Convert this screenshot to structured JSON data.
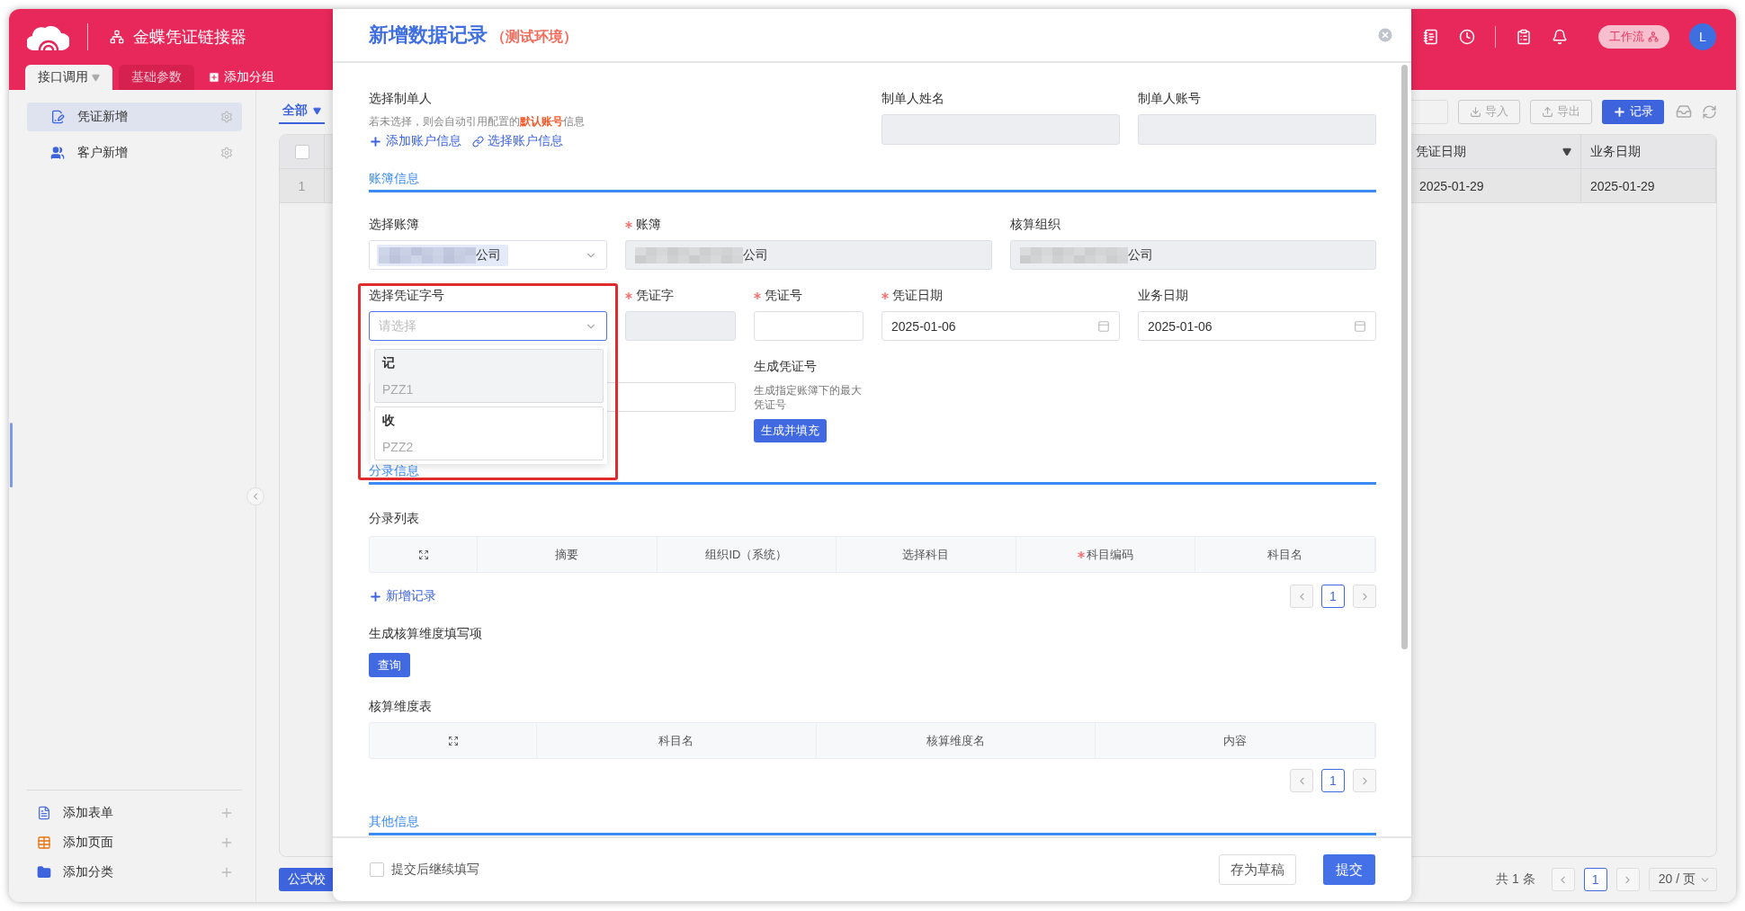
{
  "app": {
    "title": "金蝶凭证链接器",
    "workflow": "工作流",
    "avatar": "L"
  },
  "nav_tabs": [
    {
      "label": "接口调用",
      "selected": true
    },
    {
      "label": "基础参数",
      "selected": false
    }
  ],
  "add_group": "添加分组",
  "sidebar": {
    "items": [
      {
        "label": "凭证新增",
        "selected": true,
        "kind": "voucher"
      },
      {
        "label": "客户新增",
        "selected": false,
        "kind": "users"
      }
    ],
    "footer_items": [
      {
        "label": "添加表单",
        "kind": "form"
      },
      {
        "label": "添加页面",
        "kind": "page"
      },
      {
        "label": "添加分类",
        "kind": "folder"
      }
    ]
  },
  "filter_tab": {
    "label": "全部",
    "selected": true
  },
  "toolbar": [
    {
      "label": "导入",
      "kind": "import"
    },
    {
      "label": "导出",
      "kind": "export"
    },
    {
      "label": "记录",
      "kind": "add"
    }
  ],
  "table": {
    "select_all": {
      "checked": false
    },
    "columns": [
      {
        "label": "凭证日期",
        "filter": true
      },
      {
        "label": "业务日期",
        "filter": false
      }
    ],
    "rows": [
      {
        "index": "1",
        "cells": [
          "2025-01-29",
          "2025-01-29"
        ]
      }
    ]
  },
  "bottom": {
    "formula_button": "公式校",
    "total": "共 1 条",
    "page": "1",
    "page_size": "20 / 页"
  },
  "modal": {
    "title": "新增数据记录",
    "env": "（测试环境）",
    "creator": {
      "label": "选择制单人",
      "hint": "若未选择，则会自动引用配置的**默认账号**信息",
      "links": [
        {
          "label": "添加账户信息",
          "kind": "add"
        },
        {
          "label": "选择账户信息",
          "kind": "link"
        }
      ]
    },
    "creator_fields": [
      {
        "label": "制单人姓名",
        "disabled": true
      },
      {
        "label": "制单人账号",
        "disabled": true
      }
    ],
    "section_ledger": "账簿信息",
    "ledger_fields": [
      {
        "label": "选择账簿",
        "required": false,
        "kind": "select",
        "value": "公司",
        "redacted": true,
        "disabled": false,
        "focused": false
      },
      {
        "label": "账簿",
        "required": true,
        "kind": "text",
        "value": "公司",
        "redacted": true,
        "disabled": true,
        "focused": false
      },
      {
        "label": "核算组织",
        "required": false,
        "kind": "text",
        "value": "公司",
        "redacted": true,
        "disabled": true,
        "focused": false
      }
    ],
    "voucher_fields": [
      {
        "label": "选择凭证字号",
        "required": false,
        "kind": "select",
        "placeholder": "请选择",
        "disabled": false,
        "focused": true
      },
      {
        "label": "凭证字",
        "required": true,
        "kind": "text",
        "disabled": true,
        "focused": false
      },
      {
        "label": "凭证号",
        "required": true,
        "kind": "text",
        "disabled": false,
        "focused": false
      },
      {
        "label": "凭证日期",
        "required": true,
        "kind": "date",
        "value": "2025-01-06",
        "disabled": false,
        "focused": false
      },
      {
        "label": "业务日期",
        "required": false,
        "kind": "date",
        "value": "2025-01-06",
        "disabled": false,
        "focused": false
      }
    ],
    "dropdown": [
      {
        "title": "记",
        "code": "PZZ1",
        "selected": true
      },
      {
        "title": "收",
        "code": "PZZ2",
        "selected": false
      }
    ],
    "generate": {
      "label": "生成凭证号",
      "hint": "生成指定账簿下的最大凭证号",
      "button": "生成并填充"
    },
    "section_entries": "分录信息",
    "entry_list": {
      "label": "分录列表",
      "columns": [
        {
          "label": "摘要",
          "required": false
        },
        {
          "label": "组织ID（系统）",
          "required": false
        },
        {
          "label": "选择科目",
          "required": false
        },
        {
          "label": "科目编码",
          "required": true
        },
        {
          "label": "科目名",
          "required": false
        }
      ],
      "add": "新增记录",
      "page": "1"
    },
    "dimension": {
      "label": "生成核算维度填写项",
      "button": "查询"
    },
    "dimension_table": {
      "label": "核算维度表",
      "columns": [
        {
          "label": "科目名"
        },
        {
          "label": "核算维度名"
        },
        {
          "label": "内容"
        }
      ],
      "page": "1"
    },
    "section_other": "其他信息",
    "footer": {
      "continue": {
        "label": "提交后继续填写",
        "checked": false
      },
      "draft": "存为草稿",
      "submit": "提交"
    }
  }
}
